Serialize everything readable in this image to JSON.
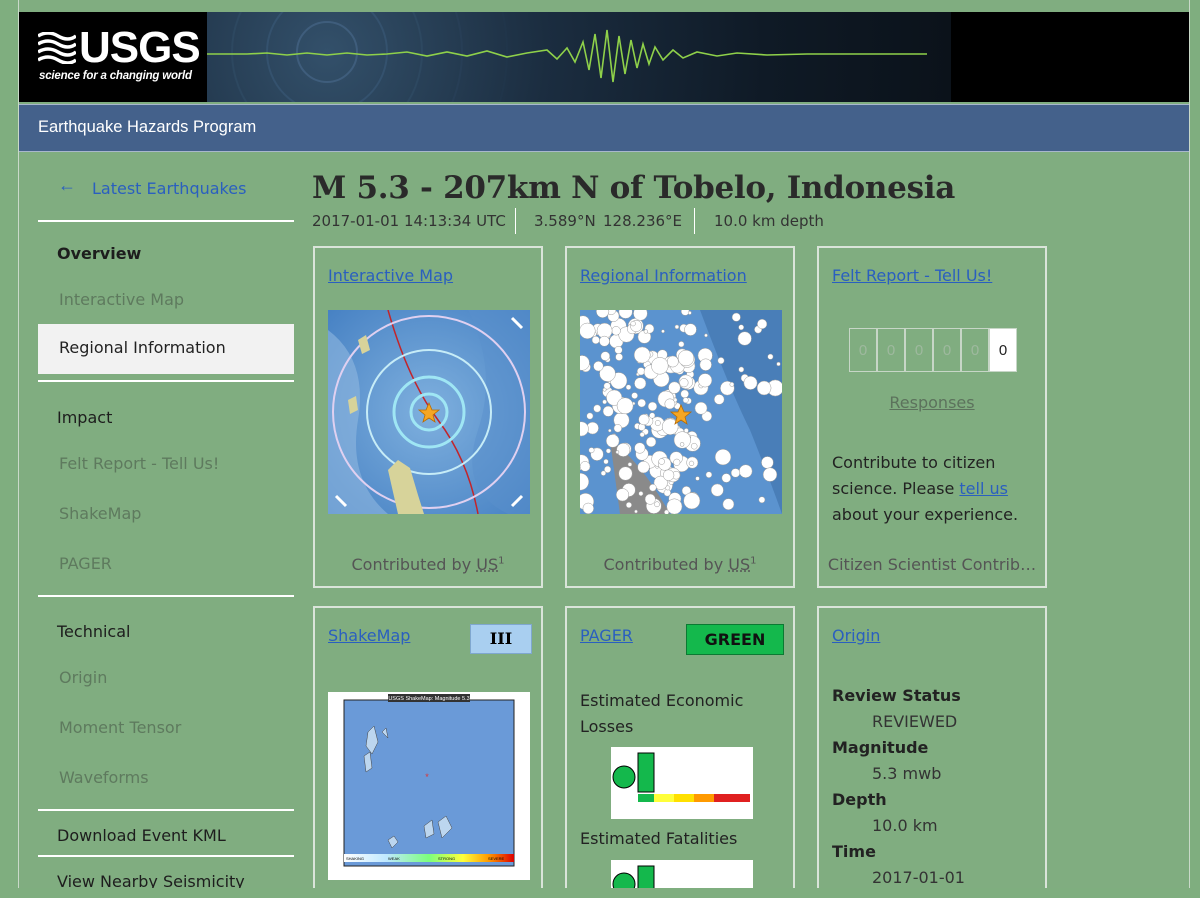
{
  "header": {
    "logo_text": "USGS",
    "logo_tagline": "science for a changing world",
    "program": "Earthquake Hazards Program"
  },
  "sidebar": {
    "back_link": "Latest Earthquakes",
    "back_icon": "left-arrow-icon",
    "overview": "Overview",
    "items": {
      "interactive_map": "Interactive Map",
      "regional_information": "Regional Information",
      "impact": "Impact",
      "felt_report": "Felt Report - Tell Us!",
      "shakemap": "ShakeMap",
      "pager": "PAGER",
      "technical": "Technical",
      "origin": "Origin",
      "moment_tensor": "Moment Tensor",
      "waveforms": "Waveforms",
      "download_kml": "Download Event KML",
      "nearby_seismicity": "View Nearby Seismicity"
    }
  },
  "event": {
    "title": "M 5.3 - 207km N of Tobelo, Indonesia",
    "time": "2017-01-01 14:13:34 UTC",
    "lat": "3.589°N",
    "lon": "128.236°E",
    "depth": "10.0 km depth"
  },
  "cards": {
    "interactive_map": {
      "title": "Interactive Map",
      "footer": "Contributed by ",
      "footer_link": "US",
      "footer_sup": "1"
    },
    "regional_information": {
      "title": "Regional Information",
      "footer": "Contributed by ",
      "footer_link": "US",
      "footer_sup": "1"
    },
    "felt_report": {
      "title": "Felt Report - Tell Us!",
      "digits": [
        "0",
        "0",
        "0",
        "0",
        "0",
        "0"
      ],
      "responses_label": "Responses",
      "body_1": "Contribute to citizen",
      "body_2a": "science. Please ",
      "body_2_link": "tell us",
      "body_3": "about your experience.",
      "footer": "Citizen Scientist Contrib…"
    },
    "shakemap": {
      "title": "ShakeMap",
      "badge": "III",
      "badge_color": "#a9cff0",
      "image_title": "USGS ShakeMap: Magnitude 5.3",
      "scale_labels": [
        "SHAKING",
        "WEAK",
        "STRONG",
        "SEVERE"
      ]
    },
    "pager": {
      "title": "PAGER",
      "badge": "GREEN",
      "badge_color": "#14b84c",
      "economic_label": "Estimated Economic Losses",
      "economic_label_1": "Estimated Economic",
      "economic_label_2": "Losses",
      "fatalities_label": "Estimated Fatalities"
    },
    "origin": {
      "title": "Origin",
      "review_status_label": "Review Status",
      "review_status": "REVIEWED",
      "magnitude_label": "Magnitude",
      "magnitude": "5.3 mwb",
      "depth_label": "Depth",
      "depth": "10.0 km",
      "time_label": "Time",
      "time": "2017-01-01"
    }
  }
}
